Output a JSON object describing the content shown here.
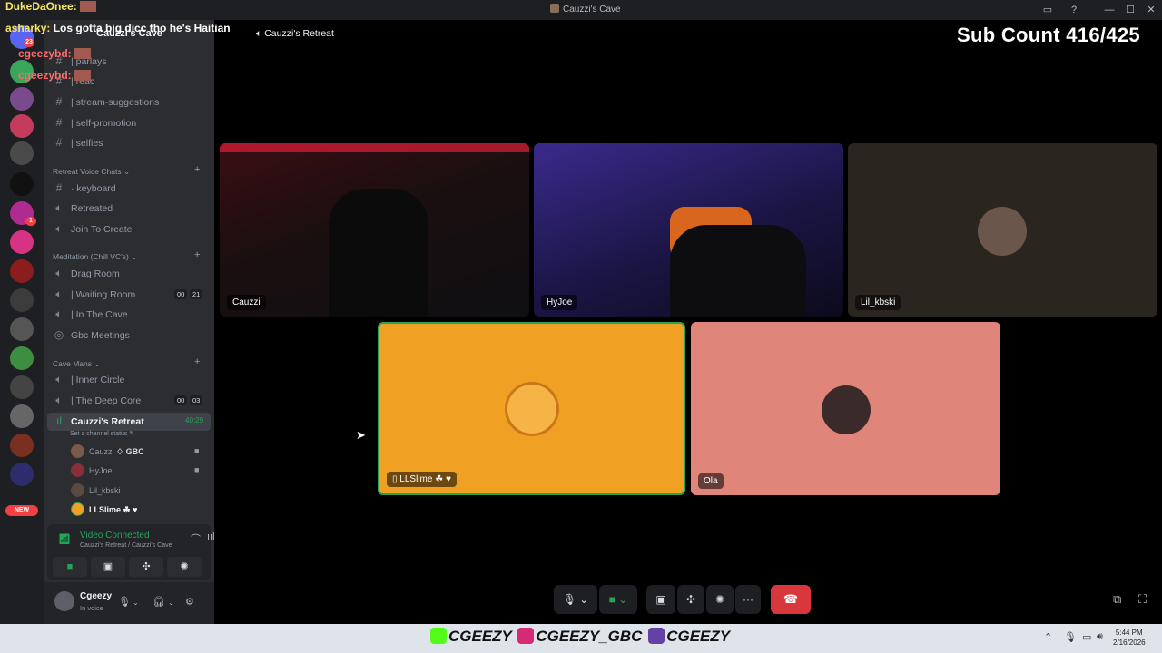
{
  "window": {
    "title": "Cauzzi's Cave"
  },
  "server": {
    "name": "Cauzzi's Cave",
    "unread_badge": "23",
    "small_badge": "1",
    "new_label": "NEW"
  },
  "channels": [
    {
      "name": "| parlays",
      "icon": "hash-icon"
    },
    {
      "name": "| reac",
      "icon": "hash-icon"
    },
    {
      "name": "| stream-suggestions",
      "icon": "hash-icon"
    },
    {
      "name": "| self-promotion",
      "icon": "hash-icon"
    },
    {
      "name": "| selfies",
      "icon": "hash-icon"
    }
  ],
  "categories": {
    "retreat": "Retreat Voice Chats",
    "meditation": "Meditation (Chill VC's)",
    "cave_mans": "Cave Mans"
  },
  "retreat_channels": [
    {
      "name": "· keyboard",
      "icon": "hash-icon"
    },
    {
      "name": "Retreated",
      "icon": "speaker-icon"
    },
    {
      "name": "Join To Create",
      "icon": "speaker-icon"
    }
  ],
  "meditation_channels": [
    {
      "name": "Drag Room",
      "icon": "speaker-icon"
    },
    {
      "name": "| Waiting Room",
      "icon": "speaker-icon",
      "count_a": "00",
      "count_b": "21"
    },
    {
      "name": "| In The Cave",
      "icon": "speaker-icon"
    },
    {
      "name": "Gbc Meetings",
      "icon": "stage-icon"
    }
  ],
  "cave_channels": [
    {
      "name": "| Inner Circle",
      "icon": "speaker-icon"
    },
    {
      "name": "| The Deep Core",
      "icon": "speaker-icon",
      "count_a": "00",
      "count_b": "03"
    },
    {
      "name": "Cauzzi's Retreat",
      "icon": "speaker-icon",
      "timer": "40:29"
    }
  ],
  "channel_status_placeholder": "Set a channel status",
  "voice_users": [
    {
      "name": "Cauzzi",
      "tag": "GBC",
      "camera": true
    },
    {
      "name": "HyJoe",
      "camera": true
    },
    {
      "name": "Lil_kbski",
      "camera": false
    },
    {
      "name": "LLSlime",
      "camera": false
    }
  ],
  "voice_panel": {
    "title": "Video Connected",
    "subtitle": "Cauzzi's Retreat / Cauzzi's Cave"
  },
  "user_panel": {
    "name": "Cgeezy",
    "status": "In voice"
  },
  "call": {
    "room_name": "Cauzzi's Retreat",
    "tiles": [
      {
        "name": "Cauzzi",
        "type": "video"
      },
      {
        "name": "HyJoe",
        "type": "video"
      },
      {
        "name": "Lil_kbski",
        "type": "avatar",
        "bg": "#2b2520"
      },
      {
        "name": "LLSlime",
        "type": "avatar",
        "bg": "#f0a123",
        "speaking": true
      },
      {
        "name": "Ola",
        "type": "avatar",
        "bg": "#e0857a"
      }
    ]
  },
  "overlay": {
    "chat": [
      {
        "name": "DukeDaOnee:",
        "message": ""
      },
      {
        "name": "asharky:",
        "message": "Los gotta big dicc tho he's Haitian"
      },
      {
        "name": "cgeezybd:",
        "message": ""
      },
      {
        "name": "cgeezybd:",
        "message": ""
      }
    ],
    "sub_count": "Sub Count 416/425"
  },
  "taskbar": {
    "socials": [
      "CGEEZY",
      "CGEEZY_GBC",
      "CGEEZY"
    ],
    "time": "5:44 PM",
    "date": "2/16/2026"
  },
  "colors": {
    "discord_green": "#23a55a",
    "hangup_red": "#da373c",
    "llslime_bg": "#f0a123",
    "ola_bg": "#e0857a"
  }
}
